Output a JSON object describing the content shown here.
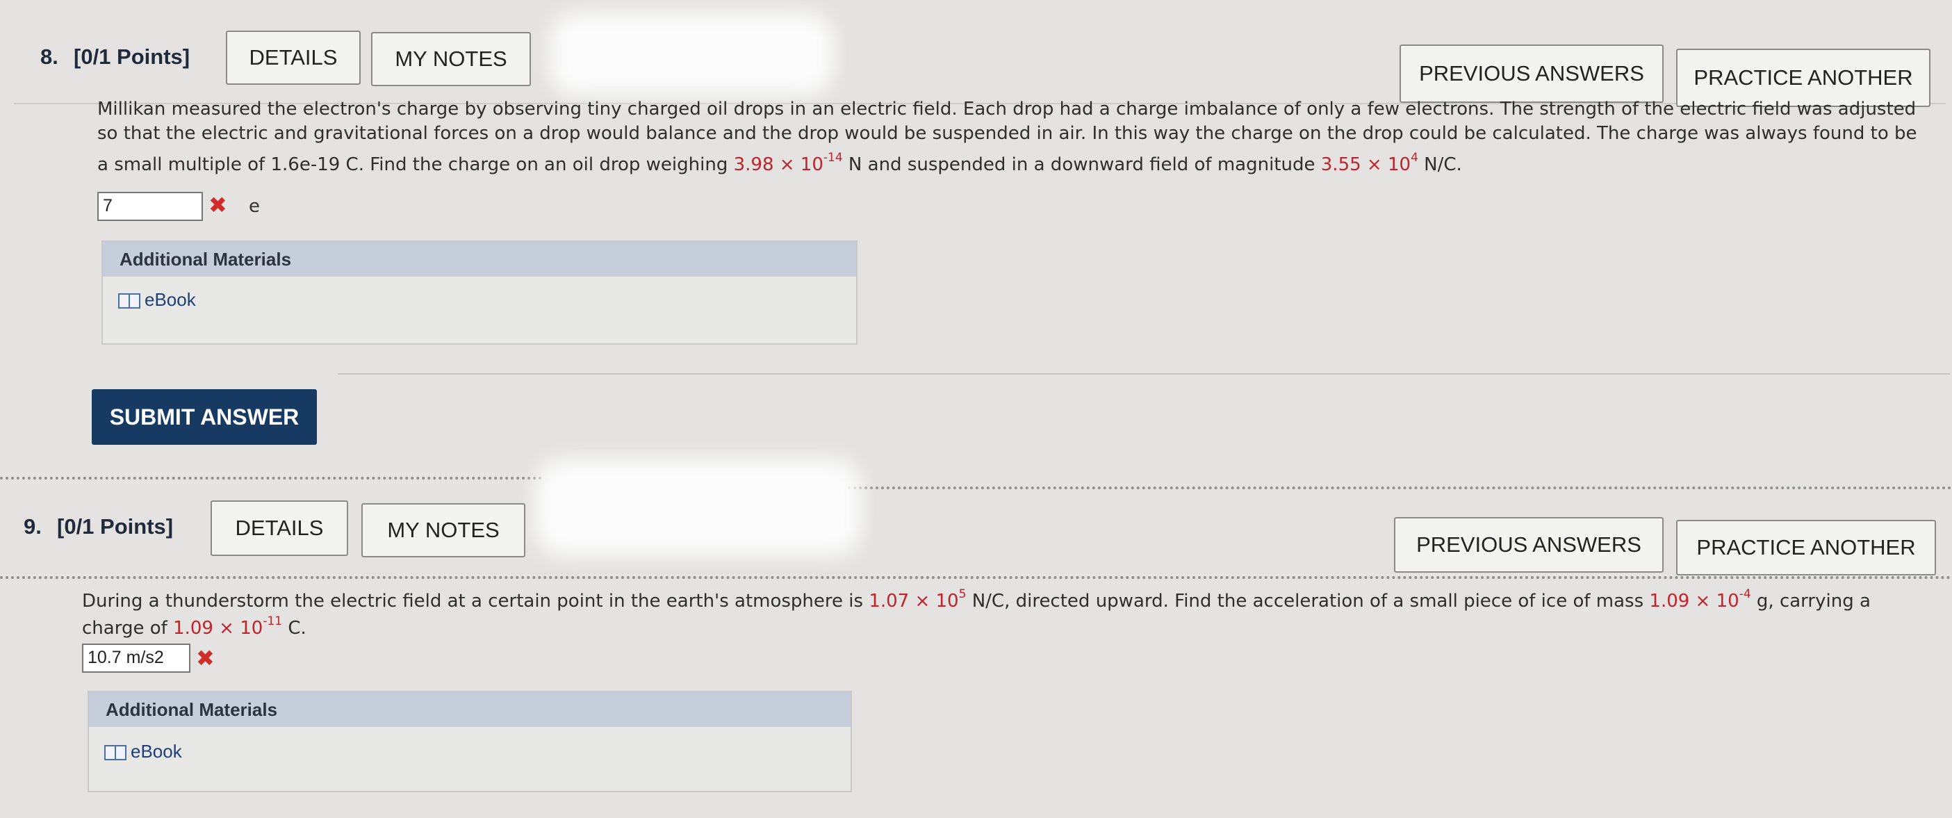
{
  "q8": {
    "number": "8.",
    "points": "[0/1 Points]",
    "details_label": "DETAILS",
    "notes_label": "MY NOTES",
    "prev_label": "PREVIOUS ANSWERS",
    "practice_label": "PRACTICE ANOTHER",
    "text_line1": "Millikan measured the electron's charge by observing tiny charged oil drops in an electric field. Each drop had a charge imbalance of only a few electrons. The strength of the electric field was adjusted",
    "text_line2": "so that the electric and gravitational forces on a drop would balance and the drop would be suspended in air. In this way the charge on the drop could be calculated. The charge was always found to be",
    "text_line3_a": "a small multiple of 1.6e-19 C. Find the charge on an oil drop weighing ",
    "weight_mant": "3.98 × 10",
    "weight_exp": "-14",
    "text_line3_b": " N and suspended in a downward field of magnitude ",
    "field_mant": "3.55 × 10",
    "field_exp": "4",
    "text_line3_c": " N/C.",
    "answer_value": "7",
    "answer_unit": "e",
    "materials_title": "Additional Materials",
    "ebook_label": "eBook",
    "submit_label": "SUBMIT ANSWER"
  },
  "q9": {
    "number": "9.",
    "points": "[0/1 Points]",
    "details_label": "DETAILS",
    "notes_label": "MY NOTES",
    "prev_label": "PREVIOUS ANSWERS",
    "practice_label": "PRACTICE ANOTHER",
    "text_line1_a": "During a thunderstorm the electric field at a certain point in the earth's atmosphere is ",
    "field_mant": "1.07 × 10",
    "field_exp": "5",
    "text_line1_b": " N/C, directed upward. Find the acceleration of a small piece of ice of mass ",
    "mass_mant": "1.09 × 10",
    "mass_exp": "-4",
    "text_line1_c": " g, carrying a",
    "text_line2_a": "charge of ",
    "charge_mant": "1.09 × 10",
    "charge_exp": "-11",
    "text_line2_b": " C.",
    "answer_value": "10.7 m/s2",
    "materials_title": "Additional Materials",
    "ebook_label": "eBook"
  },
  "colors": {
    "accent_submit": "#173a63",
    "incorrect_mark": "#d42a2a",
    "given_value": "#c0242b",
    "panel_header": "#c6cedc"
  },
  "icons": {
    "incorrect": "x-mark-icon",
    "ebook": "book-icon"
  }
}
